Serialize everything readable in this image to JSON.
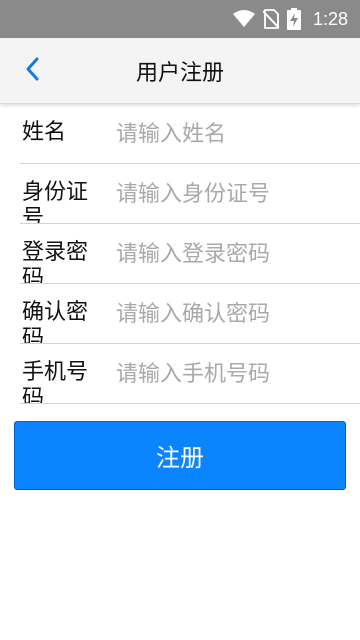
{
  "status_bar": {
    "time": "1:28",
    "icons": [
      "wifi-icon",
      "no-sim-icon",
      "battery-charging-icon"
    ]
  },
  "app_bar": {
    "back_icon": "chevron-left-icon",
    "title": "用户注册"
  },
  "form": {
    "fields": [
      {
        "label": "姓名",
        "placeholder": "请输入姓名",
        "value": ""
      },
      {
        "label": "身份证号",
        "placeholder": "请输入身份证号",
        "value": ""
      },
      {
        "label": "登录密码",
        "placeholder": "请输入登录密码",
        "value": ""
      },
      {
        "label": "确认密码",
        "placeholder": "请输入确认密码",
        "value": ""
      },
      {
        "label": "手机号码",
        "placeholder": "请输入手机号码",
        "value": ""
      }
    ],
    "submit_label": "注册"
  },
  "colors": {
    "accent": "#0a84ff",
    "status_bar": "#8a8a8a",
    "app_bar": "#f4f4f4"
  }
}
